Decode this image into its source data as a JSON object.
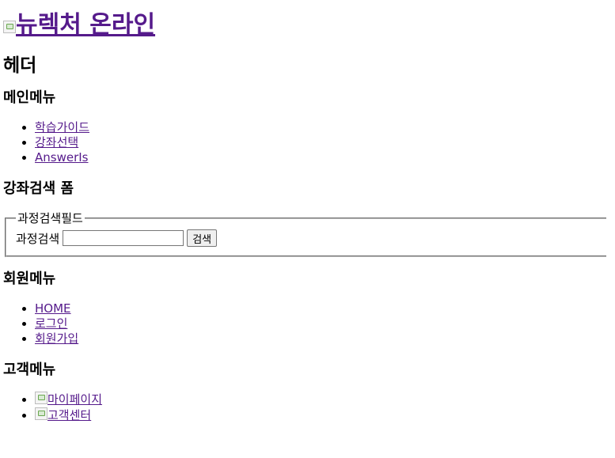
{
  "logo": {
    "alt_text": "뉴렉처 온라인",
    "icon": "broken-image-icon"
  },
  "header": {
    "title": "헤더"
  },
  "main_menu": {
    "heading": "메인메뉴",
    "items": [
      {
        "label": "학습가이드"
      },
      {
        "label": "강좌선택"
      },
      {
        "label": "AnswerIs"
      }
    ]
  },
  "search": {
    "heading": "강좌검색 폼",
    "legend": "과정검색필드",
    "label": "과정검색",
    "value": "",
    "button": "검색"
  },
  "member_menu": {
    "heading": "회원메뉴",
    "items": [
      {
        "label": "HOME"
      },
      {
        "label": "로그인"
      },
      {
        "label": "회원가입"
      }
    ]
  },
  "customer_menu": {
    "heading": "고객메뉴",
    "items": [
      {
        "label": "마이페이지",
        "icon": "broken-image-icon"
      },
      {
        "label": "고객센터",
        "icon": "broken-image-icon"
      }
    ]
  }
}
